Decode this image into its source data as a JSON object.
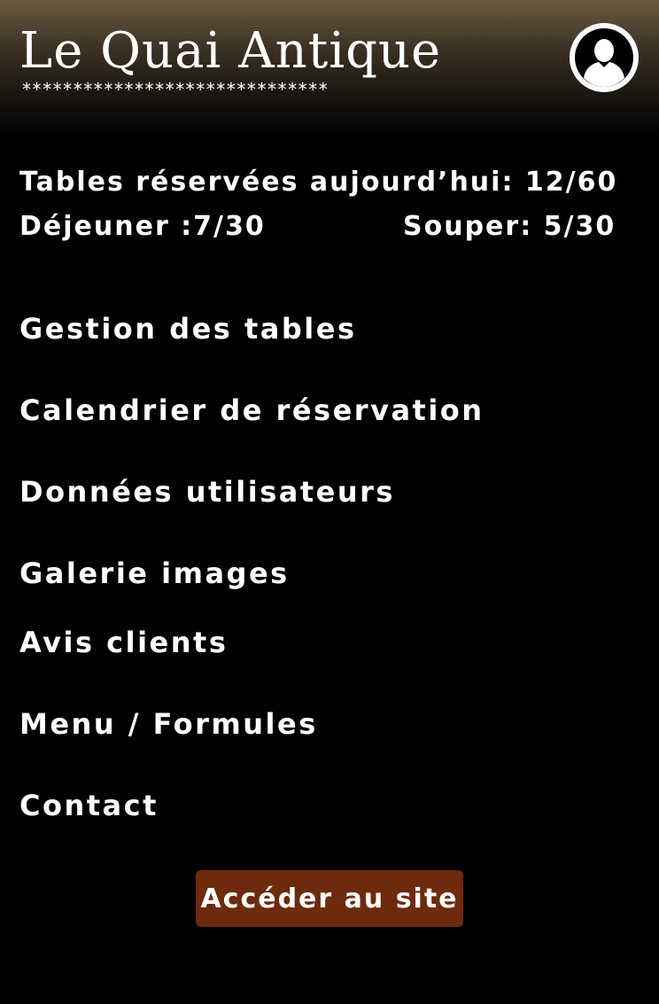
{
  "header": {
    "title": "Le Quai Antique",
    "decoration": "******************************",
    "avatar_icon": "user-profile-icon"
  },
  "stats": {
    "total": "Tables réservées aujourd’hui: 12/60",
    "lunch": "Déjeuner :7/30",
    "dinner": "Souper: 5/30"
  },
  "nav": {
    "items": [
      {
        "label": "Gestion des tables"
      },
      {
        "label": "Calendrier de réservation"
      },
      {
        "label": "Données utilisateurs"
      },
      {
        "label": "Galerie images"
      },
      {
        "label": "Avis clients"
      },
      {
        "label": "Menu / Formules"
      },
      {
        "label": "Contact"
      }
    ]
  },
  "cta": {
    "label": "Accéder au site"
  },
  "colors": {
    "background": "#000000",
    "header_gradient_top": "#6b5a3e",
    "button": "#6e2a0c",
    "text": "#ffffff"
  }
}
